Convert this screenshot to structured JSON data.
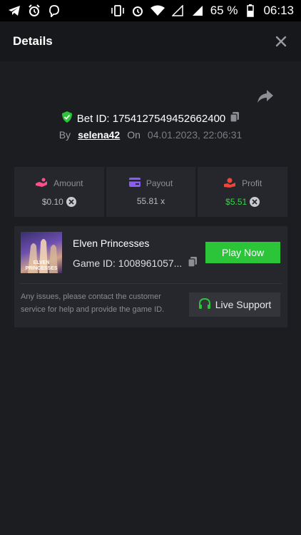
{
  "status_bar": {
    "battery": "65 %",
    "time": "06:13"
  },
  "header": {
    "title": "Details"
  },
  "bet": {
    "id_text": "Bet ID: 1754127549452662400",
    "by_label": "By",
    "user": "selena42",
    "on_label": "On",
    "date": "04.01.2023, 22:06:31"
  },
  "stats": {
    "amount": {
      "label": "Amount",
      "value": "$0.10"
    },
    "payout": {
      "label": "Payout",
      "value": "55.81 x"
    },
    "profit": {
      "label": "Profit",
      "value": "$5.51"
    }
  },
  "game": {
    "thumb_text": "ELVEN PRINCESSES",
    "title": "Elven Princesses",
    "game_id": "Game ID: 1008961057...",
    "play_label": "Play Now",
    "note": "Any issues, please contact the customer service for help and provide the game ID.",
    "support_label": "Live Support"
  },
  "colors": {
    "accent_green": "#2cc53a",
    "profit_green": "#38d24a",
    "amount_pink": "#ff4f8a",
    "payout_purple": "#8b5cf6",
    "profit_red": "#f0443a"
  }
}
